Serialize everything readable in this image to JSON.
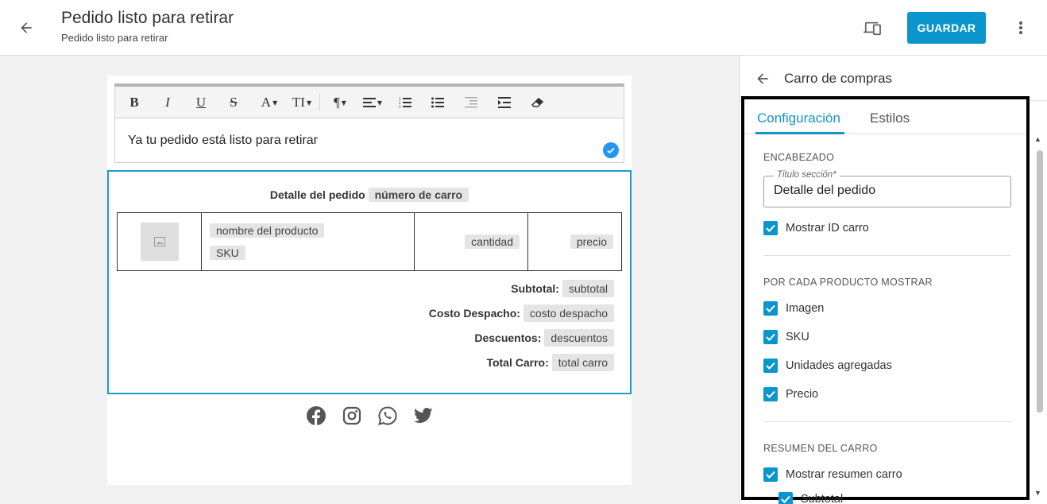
{
  "header": {
    "title": "Pedido listo para retirar",
    "subtitle": "Pedido listo para retirar",
    "save_label": "GUARDAR"
  },
  "editor": {
    "toolbar": {
      "bold": "B",
      "italic": "I",
      "underline": "U",
      "strike": "S",
      "font_color": "A",
      "text_size": "TI",
      "paragraph": "¶"
    },
    "content": "Ya tu pedido está listo para retirar"
  },
  "cart": {
    "heading_label": "Detalle del pedido",
    "heading_tag": "número de carro",
    "product": {
      "name_tag": "nombre del producto",
      "sku_tag": "SKU",
      "quantity_tag": "cantidad",
      "price_tag": "precio"
    },
    "totals": [
      {
        "label": "Subtotal:",
        "tag": "subtotal"
      },
      {
        "label": "Costo Despacho:",
        "tag": "costo despacho"
      },
      {
        "label": "Descuentos:",
        "tag": "descuentos"
      },
      {
        "label": "Total Carro:",
        "tag": "total carro"
      }
    ]
  },
  "panel": {
    "title": "Carro de compras",
    "tabs": [
      "Configuración",
      "Estilos"
    ],
    "sections": {
      "encabezado": "ENCABEZADO",
      "por_producto": "POR CADA PRODUCTO MOSTRAR",
      "resumen": "RESUMEN DEL CARRO"
    },
    "title_field": {
      "label": "Titulo sección*",
      "value": "Detalle del pedido"
    },
    "checkboxes": {
      "mostrar_id": "Mostrar ID carro",
      "imagen": "Imagen",
      "sku": "SKU",
      "unidades": "Unidades agregadas",
      "precio": "Precio",
      "mostrar_resumen": "Mostrar resumen carro",
      "subtotal": "Subtotal"
    }
  },
  "colors": {
    "accent": "#0a95cc",
    "tab_active": "#1593c9",
    "cart_border": "#1a9ccf"
  }
}
